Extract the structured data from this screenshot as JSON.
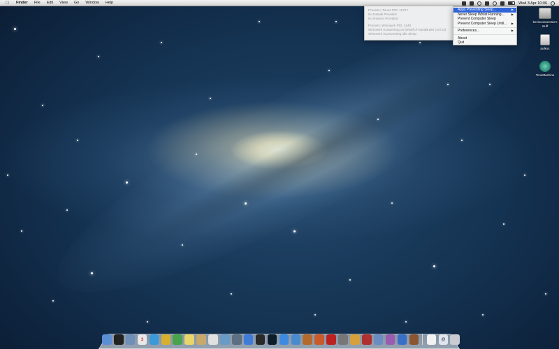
{
  "menubar": {
    "apple_icon": "apple-logo-icon",
    "app_name": "Finder",
    "menus": [
      "File",
      "Edit",
      "View",
      "Go",
      "Window",
      "Help"
    ],
    "clock": "Wed 3 Apr  10:06",
    "status_icons": [
      "caffeine-icon",
      "app-icon",
      "sync-icon",
      "bluetooth-icon",
      "wifi-icon",
      "volume-icon",
      "battery-icon",
      "spotlight-icon"
    ]
  },
  "info_panel": {
    "block1": [
      "Process: iTunes PID: 10717",
      "No Details Provided",
      "No Reason Provided"
    ],
    "block2": [
      "Process: Wimoweh PID: 4148",
      "Wimoweh is asserting on behalf of HandBrake (10713)",
      "Wimoweh is preventing idle Sleep"
    ]
  },
  "dropdown": {
    "items": [
      {
        "label": "Apps Preventing Sleep...",
        "submenu": true,
        "highlighted": true
      },
      {
        "label": "Never Sleep Whilst Running...",
        "submenu": true
      },
      {
        "label": "Prevent Computer Sleep"
      },
      {
        "label": "Prevent Computer Sleep Until...",
        "submenu": true
      },
      {
        "separator": true
      },
      {
        "label": "Preferences...",
        "submenu": true
      },
      {
        "separator": true
      },
      {
        "label": "About"
      },
      {
        "label": "Quit"
      }
    ],
    "highlight_color": "#2f64d8"
  },
  "desktop_icons": [
    {
      "label": "kevinconnectsix-stuff",
      "display": "kevinconnectsix's stuff",
      "icon": "hard-drive-icon"
    },
    {
      "label": "pulkus",
      "icon": "usb-drive-icon"
    },
    {
      "label": "TimeMachine",
      "icon": "time-machine-icon"
    }
  ],
  "dock": {
    "apps": [
      {
        "name": "finder",
        "icon": "finder-icon",
        "color": "#5a8fd6"
      },
      {
        "name": "terminal",
        "icon": "terminal-icon",
        "color": "#222"
      },
      {
        "name": "preview",
        "icon": "preview-icon",
        "color": "#6f8fb6"
      },
      {
        "name": "calendar",
        "icon": "calendar-icon",
        "color": "#e8e8e8",
        "glyph": "3"
      },
      {
        "name": "network",
        "icon": "globe-icon",
        "color": "#3a9ad9"
      },
      {
        "name": "chrome",
        "icon": "chrome-icon",
        "color": "#d8b030"
      },
      {
        "name": "evernote",
        "icon": "evernote-icon",
        "color": "#4aa34a"
      },
      {
        "name": "notes",
        "icon": "notes-icon",
        "color": "#e8d66a"
      },
      {
        "name": "photos",
        "icon": "photos-icon",
        "color": "#c9a86b"
      },
      {
        "name": "mail",
        "icon": "letter-icon",
        "color": "#e0e0e0"
      },
      {
        "name": "pixelmator",
        "icon": "pixelmator-icon",
        "color": "#6a9ac6"
      },
      {
        "name": "automator",
        "icon": "automator-icon",
        "color": "#5e6f84"
      },
      {
        "name": "tools",
        "icon": "tools-icon",
        "color": "#3f7bd8"
      },
      {
        "name": "console",
        "icon": "console-icon",
        "color": "#2a2a2a"
      },
      {
        "name": "activity",
        "icon": "activity-monitor-icon",
        "color": "#0e1d2a"
      },
      {
        "name": "appstore",
        "icon": "app-store-icon",
        "color": "#3d8be0"
      },
      {
        "name": "xcode",
        "icon": "xcode-icon",
        "color": "#4a8bd0"
      },
      {
        "name": "transmit",
        "icon": "transmit-icon",
        "color": "#b36a2b"
      },
      {
        "name": "growl",
        "icon": "growl-icon",
        "color": "#c95a2a"
      },
      {
        "name": "flashcards",
        "icon": "flashcard-icon",
        "color": "#b22"
      },
      {
        "name": "image-capture",
        "icon": "camera-icon",
        "color": "#777"
      },
      {
        "name": "filemerge",
        "icon": "filemerge-icon",
        "color": "#d8a03a"
      },
      {
        "name": "photobooth",
        "icon": "photo-booth-icon",
        "color": "#b03030"
      },
      {
        "name": "iphoto",
        "icon": "iphoto-icon",
        "color": "#6a8cc0"
      },
      {
        "name": "colorsync",
        "icon": "colorsync-icon",
        "color": "#9a5bb0"
      },
      {
        "name": "itunes",
        "icon": "itunes-icon",
        "color": "#3a6fc8"
      },
      {
        "name": "dictionary",
        "icon": "dictionary-icon",
        "color": "#8a5530"
      }
    ],
    "right": [
      {
        "name": "documents",
        "icon": "document-icon",
        "color": "#f2f2f2"
      },
      {
        "name": "email",
        "icon": "email-at-icon",
        "color": "#dfe6ee",
        "glyph": "@"
      },
      {
        "name": "trash",
        "icon": "trash-icon",
        "color": "#c8ccd2"
      }
    ]
  }
}
